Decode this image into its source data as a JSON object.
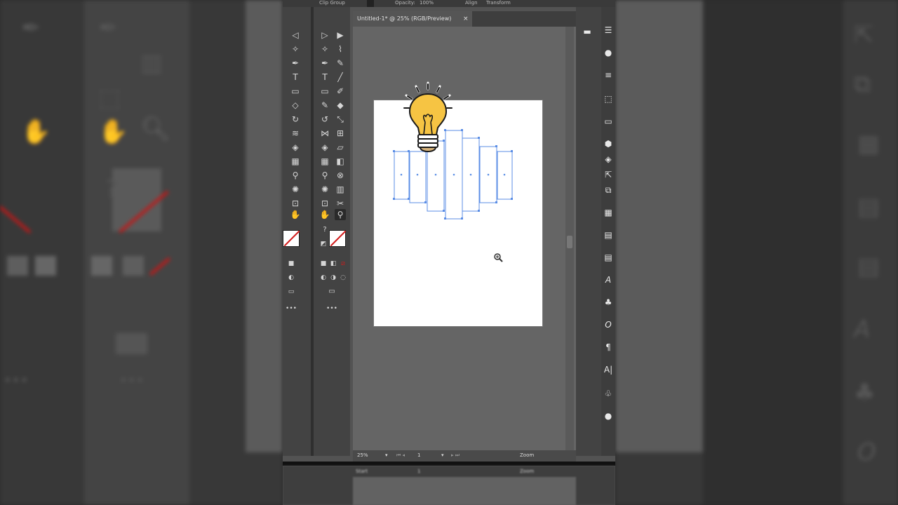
{
  "control_bar": {
    "clip_group": "Clip Group",
    "opacity_label": "Opacity:",
    "opacity_value": "100%",
    "align": "Align",
    "transform": "Transform"
  },
  "document": {
    "tab_title": "Untitled-1* @ 25% (RGB/Preview)",
    "close": "×"
  },
  "status_bar": {
    "zoom_value": "25%",
    "artboard_number": "1",
    "tool_name": "Zoom"
  },
  "reflection": {
    "left_text": "Start",
    "page": "1",
    "tool_name": "Zoom"
  },
  "colors": {
    "accent_red": "#d21c1c",
    "selection_blue": "#5b8ee6",
    "bulb_yellow": "#f6c443"
  }
}
